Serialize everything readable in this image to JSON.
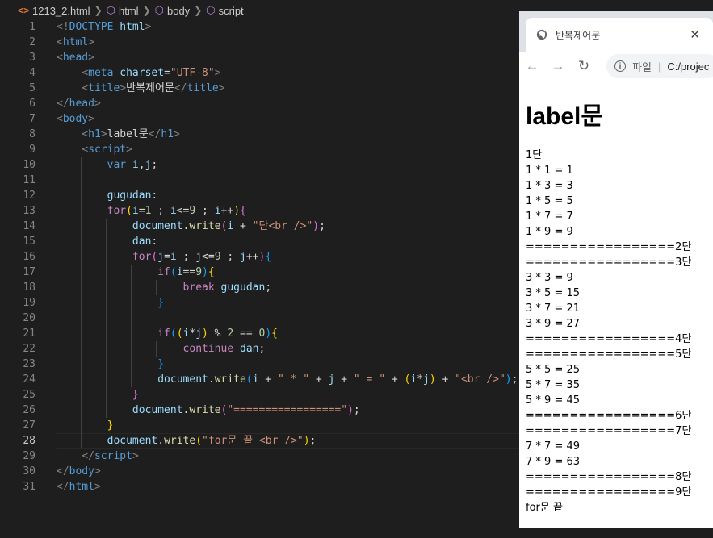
{
  "breadcrumb": {
    "file": "1213_2.html",
    "items": [
      "html",
      "body",
      "script"
    ]
  },
  "editor": {
    "current_line": 28,
    "lines": [
      [
        [
          "p",
          "<!"
        ],
        [
          "t",
          "DOCTYPE"
        ],
        [
          "w",
          " "
        ],
        [
          "a",
          "html"
        ],
        [
          "p",
          ">"
        ]
      ],
      [
        [
          "p",
          "<"
        ],
        [
          "t",
          "html"
        ],
        [
          "p",
          ">"
        ]
      ],
      [
        [
          "p",
          "<"
        ],
        [
          "t",
          "head"
        ],
        [
          "p",
          ">"
        ]
      ],
      [
        [
          "w",
          "    "
        ],
        [
          "p",
          "<"
        ],
        [
          "t",
          "meta"
        ],
        [
          "w",
          " "
        ],
        [
          "a",
          "charset"
        ],
        [
          "w",
          "="
        ],
        [
          "s",
          "\"UTF-8\""
        ],
        [
          "p",
          ">"
        ]
      ],
      [
        [
          "w",
          "    "
        ],
        [
          "p",
          "<"
        ],
        [
          "t",
          "title"
        ],
        [
          "p",
          ">"
        ],
        [
          "w",
          "반복제어문"
        ],
        [
          "p",
          "</"
        ],
        [
          "t",
          "title"
        ],
        [
          "p",
          ">"
        ]
      ],
      [
        [
          "p",
          "</"
        ],
        [
          "t",
          "head"
        ],
        [
          "p",
          ">"
        ]
      ],
      [
        [
          "p",
          "<"
        ],
        [
          "t",
          "body"
        ],
        [
          "p",
          ">"
        ]
      ],
      [
        [
          "w",
          "    "
        ],
        [
          "p",
          "<"
        ],
        [
          "t",
          "h1"
        ],
        [
          "p",
          ">"
        ],
        [
          "w",
          "label문"
        ],
        [
          "p",
          "</"
        ],
        [
          "t",
          "h1"
        ],
        [
          "p",
          ">"
        ]
      ],
      [
        [
          "w",
          "    "
        ],
        [
          "p",
          "<"
        ],
        [
          "t",
          "script"
        ],
        [
          "p",
          ">"
        ]
      ],
      [
        [
          "w",
          "        "
        ],
        [
          "kw",
          "var"
        ],
        [
          "w",
          " "
        ],
        [
          "v",
          "i"
        ],
        [
          "w",
          ","
        ],
        [
          "v",
          "j"
        ],
        [
          "w",
          ";"
        ]
      ],
      [],
      [
        [
          "w",
          "        "
        ],
        [
          "v",
          "gugudan"
        ],
        [
          "w",
          ":"
        ]
      ],
      [
        [
          "w",
          "        "
        ],
        [
          "k",
          "for"
        ],
        [
          "y",
          "("
        ],
        [
          "v",
          "i"
        ],
        [
          "w",
          "="
        ],
        [
          "n",
          "1"
        ],
        [
          "w",
          " ; "
        ],
        [
          "v",
          "i"
        ],
        [
          "w",
          "<="
        ],
        [
          "n",
          "9"
        ],
        [
          "w",
          " ; "
        ],
        [
          "v",
          "i"
        ],
        [
          "w",
          "++"
        ],
        [
          "y",
          ")"
        ],
        [
          "m",
          "{"
        ]
      ],
      [
        [
          "w",
          "            "
        ],
        [
          "v",
          "document"
        ],
        [
          "w",
          "."
        ],
        [
          "f",
          "write"
        ],
        [
          "m",
          "("
        ],
        [
          "v",
          "i"
        ],
        [
          "w",
          " + "
        ],
        [
          "s",
          "\"단<br />\""
        ],
        [
          "m",
          ")"
        ],
        [
          "w",
          ";"
        ]
      ],
      [
        [
          "w",
          "            "
        ],
        [
          "v",
          "dan"
        ],
        [
          "w",
          ":"
        ]
      ],
      [
        [
          "w",
          "            "
        ],
        [
          "k",
          "for"
        ],
        [
          "m",
          "("
        ],
        [
          "v",
          "j"
        ],
        [
          "w",
          "="
        ],
        [
          "v",
          "i"
        ],
        [
          "w",
          " ; "
        ],
        [
          "v",
          "j"
        ],
        [
          "w",
          "<="
        ],
        [
          "n",
          "9"
        ],
        [
          "w",
          " ; "
        ],
        [
          "v",
          "j"
        ],
        [
          "w",
          "++"
        ],
        [
          "m",
          ")"
        ],
        [
          "b",
          "{"
        ]
      ],
      [
        [
          "w",
          "                "
        ],
        [
          "k",
          "if"
        ],
        [
          "b",
          "("
        ],
        [
          "v",
          "i"
        ],
        [
          "w",
          "=="
        ],
        [
          "n",
          "9"
        ],
        [
          "b",
          ")"
        ],
        [
          "y",
          "{"
        ]
      ],
      [
        [
          "w",
          "                    "
        ],
        [
          "k",
          "break"
        ],
        [
          "w",
          " "
        ],
        [
          "v",
          "gugudan"
        ],
        [
          "w",
          ";"
        ]
      ],
      [
        [
          "w",
          "                "
        ],
        [
          "b",
          "}"
        ]
      ],
      [],
      [
        [
          "w",
          "                "
        ],
        [
          "k",
          "if"
        ],
        [
          "b",
          "("
        ],
        [
          "y",
          "("
        ],
        [
          "v",
          "i"
        ],
        [
          "w",
          "*"
        ],
        [
          "v",
          "j"
        ],
        [
          "y",
          ")"
        ],
        [
          "w",
          " % "
        ],
        [
          "n",
          "2"
        ],
        [
          "w",
          " == "
        ],
        [
          "n",
          "0"
        ],
        [
          "b",
          ")"
        ],
        [
          "y",
          "{"
        ]
      ],
      [
        [
          "w",
          "                    "
        ],
        [
          "k",
          "continue"
        ],
        [
          "w",
          " "
        ],
        [
          "v",
          "dan"
        ],
        [
          "w",
          ";"
        ]
      ],
      [
        [
          "w",
          "                "
        ],
        [
          "b",
          "}"
        ]
      ],
      [
        [
          "w",
          "                "
        ],
        [
          "v",
          "document"
        ],
        [
          "w",
          "."
        ],
        [
          "f",
          "write"
        ],
        [
          "b",
          "("
        ],
        [
          "v",
          "i"
        ],
        [
          "w",
          " + "
        ],
        [
          "s",
          "\" * \""
        ],
        [
          "w",
          " + "
        ],
        [
          "v",
          "j"
        ],
        [
          "w",
          " + "
        ],
        [
          "s",
          "\" = \""
        ],
        [
          "w",
          " + "
        ],
        [
          "y",
          "("
        ],
        [
          "v",
          "i"
        ],
        [
          "w",
          "*"
        ],
        [
          "v",
          "j"
        ],
        [
          "y",
          ")"
        ],
        [
          "w",
          " + "
        ],
        [
          "s",
          "\"<br />\""
        ],
        [
          "b",
          ")"
        ],
        [
          "w",
          ";"
        ]
      ],
      [
        [
          "w",
          "            "
        ],
        [
          "m",
          "}"
        ]
      ],
      [
        [
          "w",
          "            "
        ],
        [
          "v",
          "document"
        ],
        [
          "w",
          "."
        ],
        [
          "f",
          "write"
        ],
        [
          "m",
          "("
        ],
        [
          "s",
          "\"=================\""
        ],
        [
          "m",
          ")"
        ],
        [
          "w",
          ";"
        ]
      ],
      [
        [
          "w",
          "        "
        ],
        [
          "y",
          "}"
        ]
      ],
      [
        [
          "w",
          "        "
        ],
        [
          "v",
          "document"
        ],
        [
          "w",
          "."
        ],
        [
          "f",
          "write"
        ],
        [
          "y",
          "("
        ],
        [
          "s",
          "\"for문 끝 <br />\""
        ],
        [
          "y",
          ")"
        ],
        [
          "w",
          ";"
        ]
      ],
      [
        [
          "w",
          "    "
        ],
        [
          "p",
          "</"
        ],
        [
          "t",
          "script"
        ],
        [
          "p",
          ">"
        ]
      ],
      [
        [
          "p",
          "</"
        ],
        [
          "t",
          "body"
        ],
        [
          "p",
          ">"
        ]
      ],
      [
        [
          "p",
          "</"
        ],
        [
          "t",
          "html"
        ],
        [
          "p",
          ">"
        ]
      ]
    ]
  },
  "browser": {
    "tab_title": "반복제어문",
    "close_glyph": "✕",
    "omnibox_label": "파일",
    "omnibox_path": "C:/projec",
    "heading": "label문",
    "output_lines": [
      "1단",
      "1 * 1 = 1",
      "1 * 3 = 3",
      "1 * 5 = 5",
      "1 * 7 = 7",
      "1 * 9 = 9",
      "=================2단",
      "=================3단",
      "3 * 3 = 9",
      "3 * 5 = 15",
      "3 * 7 = 21",
      "3 * 9 = 27",
      "=================4단",
      "=================5단",
      "5 * 5 = 25",
      "5 * 7 = 35",
      "5 * 9 = 45",
      "=================6단",
      "=================7단",
      "7 * 7 = 49",
      "7 * 9 = 63",
      "=================8단",
      "=================9단",
      "for문 끝"
    ]
  }
}
